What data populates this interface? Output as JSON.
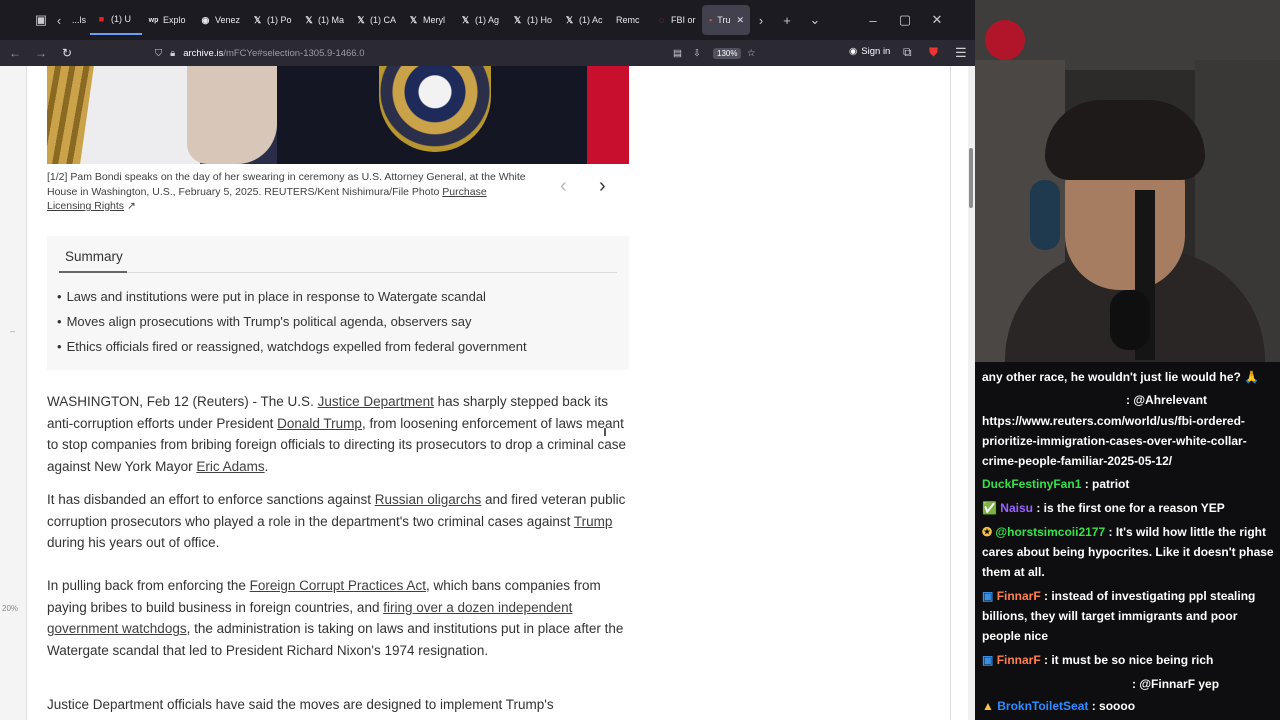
{
  "browser": {
    "tabs": [
      {
        "label": "...ls",
        "icon": "page-icon"
      },
      {
        "label": "(1) U",
        "icon": "cnn-icon"
      },
      {
        "label": "Explo",
        "icon": "wp-icon"
      },
      {
        "label": "Venez",
        "icon": "globe-icon"
      },
      {
        "label": "(1) Po",
        "icon": "x-icon"
      },
      {
        "label": "(1) Ma",
        "icon": "x-icon"
      },
      {
        "label": "(1) CA",
        "icon": "x-icon"
      },
      {
        "label": "Meryl",
        "icon": "x-icon"
      },
      {
        "label": "(1) Ag",
        "icon": "x-icon"
      },
      {
        "label": "(1) Ho",
        "icon": "x-icon"
      },
      {
        "label": "(1) Ac",
        "icon": "x-icon"
      },
      {
        "label": "Remc",
        "icon": "page-icon"
      },
      {
        "label": "FBI or",
        "icon": "globe-icon"
      },
      {
        "label": "Tru",
        "icon": "page-icon",
        "active": true
      }
    ],
    "url_host": "archive.is",
    "url_path": "/mFCYe#selection-1305.9-1466.0",
    "zoom": "130%",
    "sign_in": "Sign in"
  },
  "article": {
    "caption": "[1/2] Pam Bondi speaks on the day of her swearing in ceremony as U.S. Attorney General, at the White House in Washington, U.S., February 5, 2025. REUTERS/Kent Nishimura/File Photo ",
    "caption_link1": "Purchase",
    "caption_link2": "Licensing Rights",
    "summary_title": "Summary",
    "summary_items": [
      "Laws and institutions were put in place in response to Watergate scandal",
      "Moves align prosecutions with Trump's political agenda, observers say",
      "Ethics officials fired or reassigned, watchdogs expelled from federal government"
    ],
    "p1": {
      "a": "WASHINGTON, Feb 12 (Reuters) - The U.S. ",
      "link1": "Justice Department",
      "b": " has sharply stepped back its anti-corruption efforts under President ",
      "link2": "Donald Trump",
      "c": ", from loosening enforcement of laws meant to stop companies from bribing foreign officials to directing its prosecutors to drop a criminal case against New York Mayor ",
      "link3": "Eric Adams",
      "d": "."
    },
    "p2": {
      "a": "It has disbanded an effort to enforce sanctions against ",
      "link1": "Russian oligarchs",
      "b": " and fired veteran public corruption prosecutors who played a role in the department's two criminal cases against ",
      "link2": "Trump",
      "c": " during his years out of office."
    },
    "p3": {
      "a": "In pulling back from enforcing the ",
      "link1": "Foreign Corrupt Practices Act",
      "b": ", which bans companies from paying bribes to build business in foreign countries, and ",
      "link2": "firing over a dozen independent government watchdogs",
      "c": ", the administration is taking on laws and institutions put in place after the Watergate scandal that led to President Richard Nixon's 1974 resignation."
    },
    "p4": "Justice Department officials have said the moves are designed to implement Trump's",
    "gutter_pct": "20%"
  },
  "chat": {
    "lines": [
      {
        "user": "",
        "text": "any other race, he wouldn't just lie would he?"
      },
      {
        "user": "",
        "text": ": @Ahrelevant"
      },
      {
        "user": "",
        "text": "https://www.reuters.com/world/us/fbi-ordered-prioritize-immigration-cases-over-white-collar-crime-people-familiar-2025-05-12/"
      },
      {
        "user": "DuckFestinyFan1",
        "text": " : patriot"
      },
      {
        "user": "Naisu",
        "text": " : is the first one for a reason YEP"
      },
      {
        "user": "@horstsimcoii2177",
        "text": " : It's wild how little the right cares about being hypocrites. Like it doesn't phase them at all."
      },
      {
        "user": "FinnarF",
        "text": " : instead of investigating ppl stealing billions, they will target immigrants and poor people nice"
      },
      {
        "user": "FinnarF",
        "text": " : it must be so nice being rich"
      },
      {
        "user": "",
        "text": ": @FinnarF yep"
      },
      {
        "user": "BroknToiletSeat",
        "text": " : soooo"
      }
    ]
  }
}
